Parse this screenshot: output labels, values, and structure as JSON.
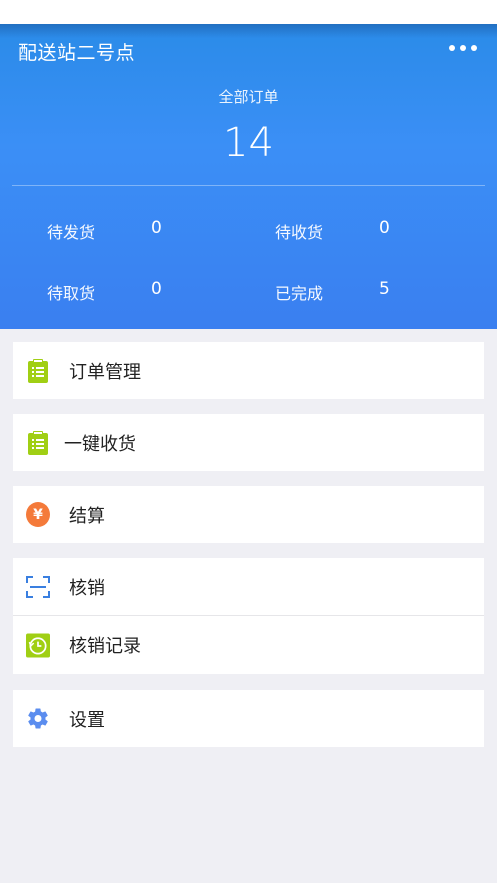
{
  "header": {
    "station_name": "配送站二号点",
    "total_label": "全部订单",
    "total_count": "14",
    "stats": [
      {
        "label": "待发货",
        "value": "0"
      },
      {
        "label": "待收货",
        "value": "0"
      },
      {
        "label": "待取货",
        "value": "0"
      },
      {
        "label": "已完成",
        "value": "5"
      }
    ]
  },
  "menu": {
    "order_management": "订单管理",
    "one_click_receive": "一键收货",
    "settlement": "结算",
    "settlement_symbol": "¥",
    "verify": "核销",
    "verify_records": "核销记录",
    "settings": "设置"
  },
  "colors": {
    "header_blue": "#3b8ff6",
    "clipboard_green": "#a0cf14",
    "settlement_orange": "#f47a3a",
    "scan_blue": "#3a7fe0",
    "settings_blue": "#5b8def"
  },
  "icons": {
    "order_management": "clipboard-list-icon",
    "one_click_receive": "clipboard-list-icon",
    "settlement": "yuan-coin-icon",
    "verify": "scan-frame-icon",
    "verify_records": "clock-history-icon",
    "settings": "gear-icon"
  }
}
